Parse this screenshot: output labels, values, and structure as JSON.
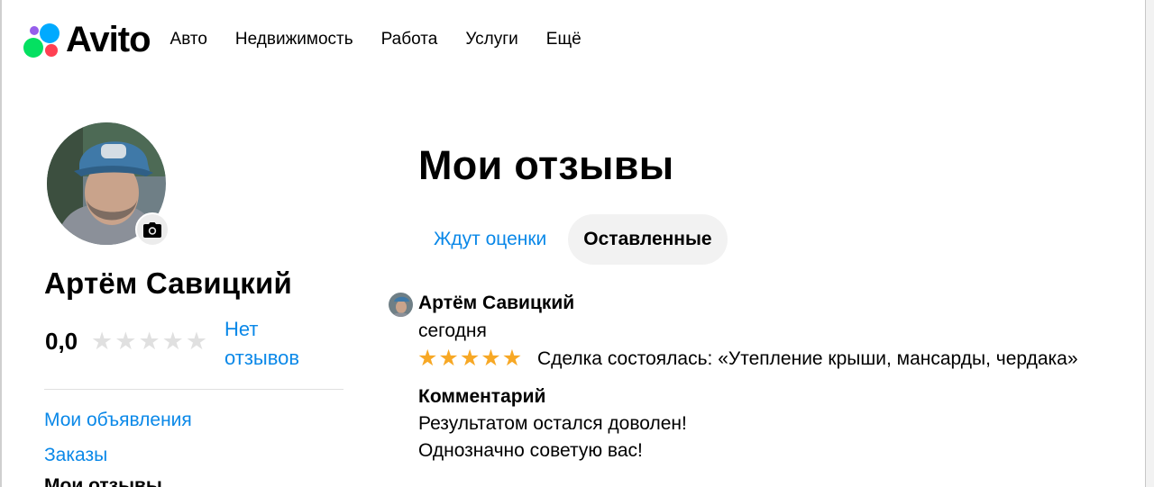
{
  "header": {
    "logo_text": "Avito",
    "nav": [
      "Авто",
      "Недвижимость",
      "Работа",
      "Услуги",
      "Ещё"
    ]
  },
  "profile": {
    "name": "Артём Савицкий",
    "rating_value": "0,0",
    "rating_stars": 0,
    "no_reviews_label": "Нет отзывов",
    "photo_icon": "camera-icon",
    "links": [
      "Мои объявления",
      "Заказы"
    ],
    "cut_item": "Мои отзывы"
  },
  "main": {
    "title": "Мои отзывы",
    "tabs": [
      {
        "label": "Ждут оценки",
        "active": false
      },
      {
        "label": "Оставленные",
        "active": true
      }
    ]
  },
  "review": {
    "author": "Артём Савицкий",
    "date": "сегодня",
    "stars": 5,
    "deal": "Сделка состоялась: «Утепление крыши, мансарды, чердака»",
    "comment_label": "Комментарий",
    "comment_lines": [
      "Результатом остался доволен!",
      "Однозначно советую вас!"
    ]
  },
  "colors": {
    "link": "#0a88e8",
    "star_filled": "#f7a825",
    "star_empty": "#e0e0e0",
    "tab_active_bg": "#f2f2f2",
    "logo_dots": [
      "#965eeb",
      "#0af",
      "#04e061",
      "#ff4053"
    ]
  }
}
